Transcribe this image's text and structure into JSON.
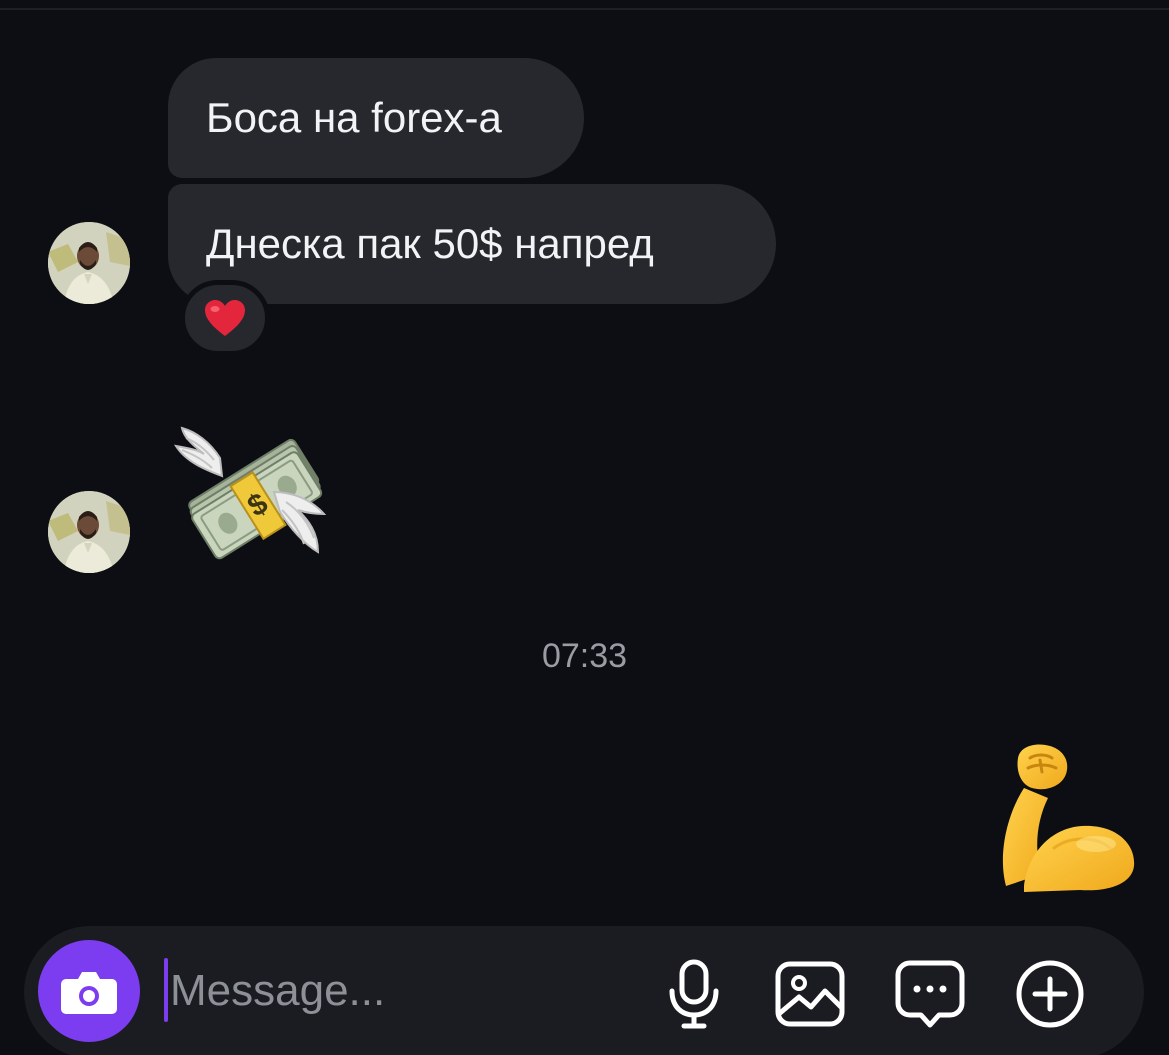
{
  "conversation": {
    "messages": [
      {
        "sender": "received",
        "text": "Боса на forex-а"
      },
      {
        "sender": "received",
        "text": "Днеска пак 50$ напред",
        "reaction": "heart"
      }
    ],
    "stickers": [
      {
        "sender": "received",
        "icon": "money-with-wings"
      },
      {
        "sender": "sent",
        "icon": "flexed-biceps"
      }
    ],
    "timestamp": "07:33"
  },
  "composer": {
    "placeholder": "Message...",
    "value": "",
    "buttons": [
      "camera-icon",
      "microphone-icon",
      "gallery-icon",
      "chat-bubble-icon",
      "plus-circle-icon"
    ]
  },
  "colors": {
    "background": "#0c0e13",
    "bubble": "#26282e",
    "accent": "#7c3df0",
    "timestamp": "#9a9ca3"
  }
}
